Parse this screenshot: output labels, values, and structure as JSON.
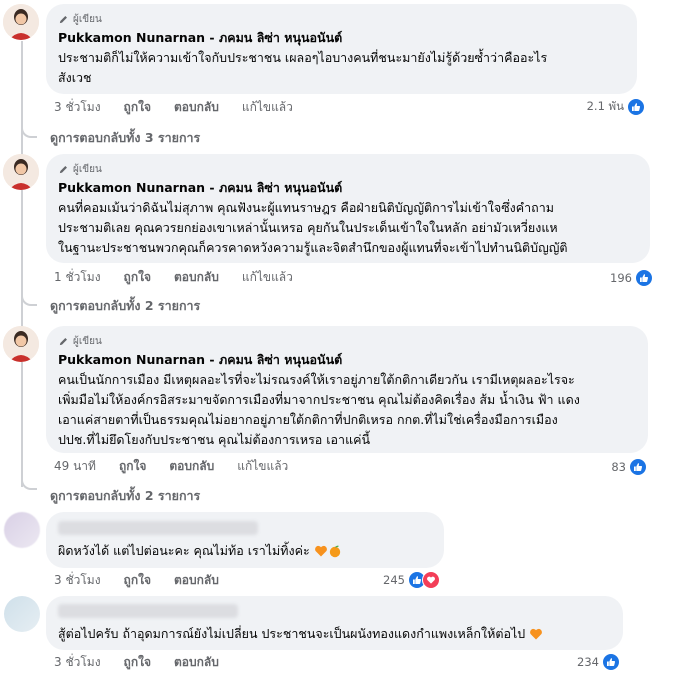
{
  "comments": [
    {
      "badge": "ผู้เขียน",
      "author": "Pukkamon Nunarnan - ภคมน ลิซ่า หนุนอนันต์",
      "lines": [
        "ประชามติก็ไม่ให้ความเข้าใจกับประชาชน เผลอๆไอบางคนที่ชนะมายังไม่รู้ด้วยซ้ำว่าคืออะไร",
        "สังเวช"
      ],
      "time": "3 ชั่วโมง",
      "like": "ถูกใจ",
      "reply": "ตอบกลับ",
      "edited": "แก้ไขแล้ว",
      "reactions": "2.1 พัน",
      "view_replies": "ดูการตอบกลับทั้ง 3 รายการ"
    },
    {
      "badge": "ผู้เขียน",
      "author": "Pukkamon Nunarnan - ภคมน ลิซ่า หนุนอนันต์",
      "lines": [
        "คนที่คอมเม้นว่าดิฉันไม่สุภาพ คุณฟังนะผู้แทนราษฎร คือฝ่ายนิติบัญญัติการไม่เข้าใจซึ่งคำถาม",
        "ประชามติเลย คุณควรยกย่องเขาเหล่านั้นเหรอ คุยกันในประเด็นเข้าใจในหลัก อย่ามัวเหวี่ยงแห",
        "ในฐานะประชาชนพวกคุณก็ควรคาดหวังความรู้และจิตสำนึกของผู้แทนที่จะเข้าไปทำนนิติบัญญัติ"
      ],
      "time": "1 ชั่วโมง",
      "like": "ถูกใจ",
      "reply": "ตอบกลับ",
      "edited": "แก้ไขแล้ว",
      "reactions": "196",
      "view_replies": "ดูการตอบกลับทั้ง 2 รายการ"
    },
    {
      "badge": "ผู้เขียน",
      "author": "Pukkamon Nunarnan - ภคมน ลิซ่า หนุนอนันต์",
      "lines": [
        "คนเป็นนักการเมือง มีเหตุผลอะไรที่จะไม่รณรงค์ให้เราอยู่ภายใต้กติกาเดียวกัน เรามีเหตุผลอะไรจะ",
        "เพิ่มมือไม่ให้องค์กรอิสระมาขจัดการเมืองที่มาจากประชาชน คุณไม่ต้องคิดเรื่อง ส้ม น้ำเงิน ฟ้า แดง",
        "เอาแค่สายตาที่เป็นธรรมคุณไม่อยากอยู่ภายใต้กติกาที่ปกติเหรอ กกต.ที่ไม่ใช่เครื่องมือการเมือง",
        "ปปช.ที่ไม่ยึดโยงกับประชาชน คุณไม่ต้องการเหรอ เอาแค่นี้"
      ],
      "time": "49 นาที",
      "like": "ถูกใจ",
      "reply": "ตอบกลับ",
      "edited": "แก้ไขแล้ว",
      "reactions": "83",
      "view_replies": "ดูการตอบกลับทั้ง 2 รายการ"
    },
    {
      "text": "ผิดหวังได้ แต่ไปต่อนะคะ คุณไม่ท้อ เราไม่ทิ้งค่ะ",
      "time": "3 ชั่วโมง",
      "like": "ถูกใจ",
      "reply": "ตอบกลับ",
      "reactions": "245"
    },
    {
      "text": "สู้ต่อไปครับ ถ้าอุดมการณ์ยังไม่เปลี่ยน ประชาชนจะเป็นผนังทองแดงกำแพงเหล็กให้ต่อไป",
      "time": "3 ชั่วโมง",
      "like": "ถูกใจ",
      "reply": "ตอบกลับ",
      "reactions": "234"
    }
  ],
  "icons": {
    "badge": "pen-icon",
    "like": "thumbs-up-icon",
    "love": "heart-icon",
    "heart_emoji": "orange-heart-emoji",
    "fruit_emoji": "tangerine-emoji"
  },
  "colors": {
    "like": "#1b74e4",
    "love": "#f33e58",
    "bubble": "#f0f2f5",
    "meta": "#65676b",
    "orange_heart": "#f7921e"
  }
}
